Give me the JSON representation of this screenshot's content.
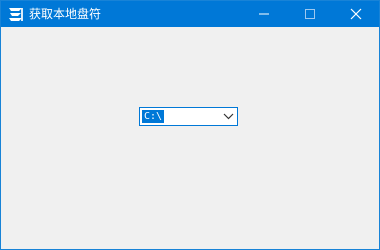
{
  "window": {
    "title": "获取本地盘符",
    "icon": "app-logo-icon"
  },
  "controls": {
    "minimize_icon": "minimize-icon",
    "maximize_icon": "maximize-icon",
    "close_icon": "close-icon"
  },
  "drive_select": {
    "value": "C:\\",
    "icon": "chevron-down-icon"
  },
  "colors": {
    "titlebar": "#0078d7",
    "client_bg": "#f0f0f0",
    "selection": "#0078d7"
  }
}
